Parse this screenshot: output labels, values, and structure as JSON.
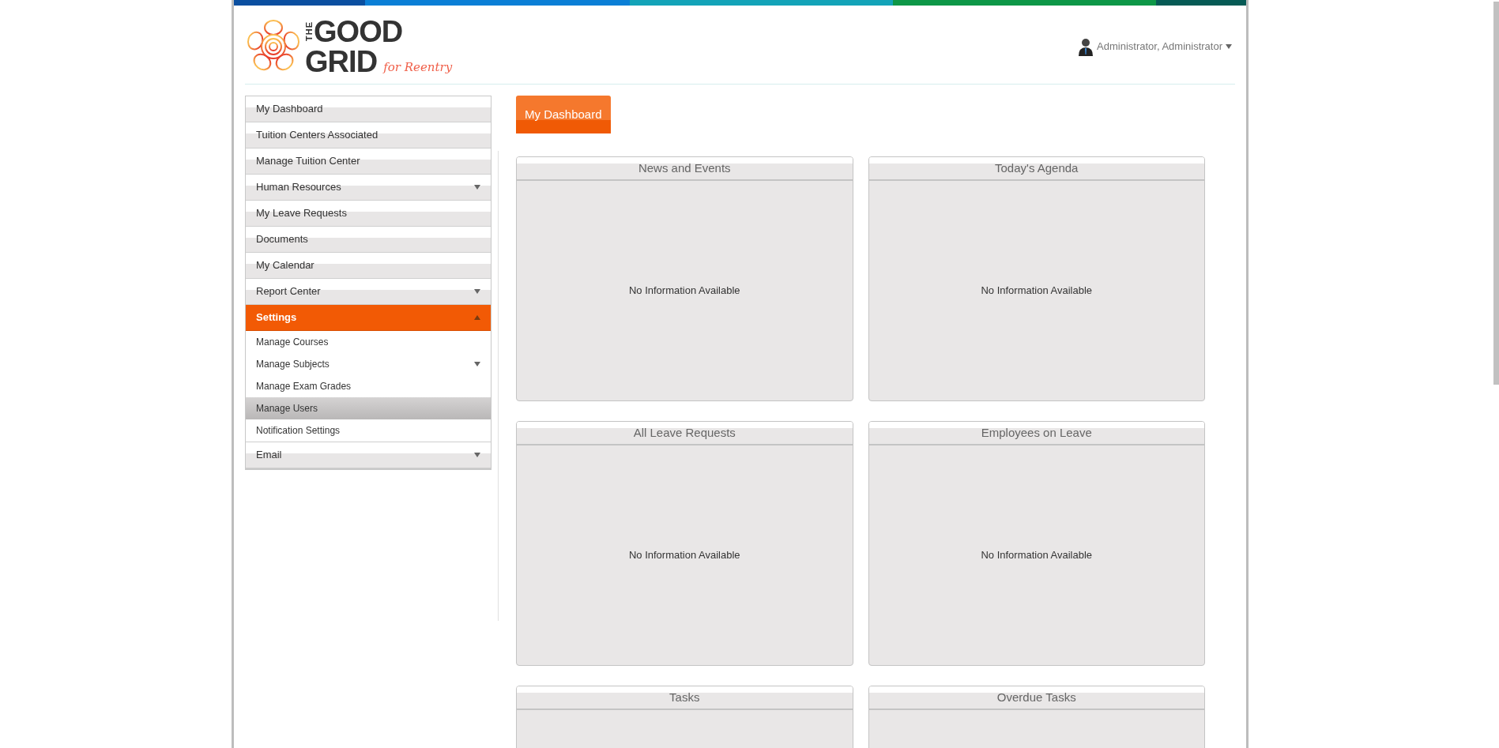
{
  "logo": {
    "the": "THE",
    "good": "GOOD",
    "grid": "GRID",
    "tagline": "for Reentry"
  },
  "user_menu": {
    "name": "Administrator, Administrator"
  },
  "sidebar": {
    "items": [
      {
        "label": "My Dashboard",
        "selected": false,
        "has_submenu": false
      },
      {
        "label": "Tuition Centers Associated",
        "selected": false,
        "has_submenu": false
      },
      {
        "label": "Manage Tuition Center",
        "selected": false,
        "has_submenu": false
      },
      {
        "label": "Human Resources",
        "selected": false,
        "has_submenu": true,
        "expanded": false
      },
      {
        "label": "My Leave Requests",
        "selected": false,
        "has_submenu": false
      },
      {
        "label": "Documents",
        "selected": false,
        "has_submenu": false
      },
      {
        "label": "My Calendar",
        "selected": false,
        "has_submenu": false
      },
      {
        "label": "Report Center",
        "selected": false,
        "has_submenu": true,
        "expanded": false
      },
      {
        "label": "Settings",
        "selected": true,
        "has_submenu": true,
        "expanded": true,
        "children": [
          {
            "label": "Manage Courses",
            "selected": false,
            "has_submenu": false
          },
          {
            "label": "Manage Subjects",
            "selected": false,
            "has_submenu": true
          },
          {
            "label": "Manage Exam Grades",
            "selected": false,
            "has_submenu": false
          },
          {
            "label": "Manage Users",
            "selected": true,
            "has_submenu": false
          },
          {
            "label": "Notification Settings",
            "selected": false,
            "has_submenu": false
          }
        ]
      },
      {
        "label": "Email",
        "selected": false,
        "has_submenu": true,
        "expanded": false
      }
    ]
  },
  "page_button": "My Dashboard",
  "panels": [
    {
      "title": "News and Events",
      "message": "No Information Available"
    },
    {
      "title": "Today's Agenda",
      "message": "No Information Available"
    },
    {
      "title": "All Leave Requests",
      "message": "No Information Available"
    },
    {
      "title": "Employees on Leave",
      "message": "No Information Available"
    },
    {
      "title": "Tasks"
    },
    {
      "title": "Overdue Tasks"
    }
  ]
}
